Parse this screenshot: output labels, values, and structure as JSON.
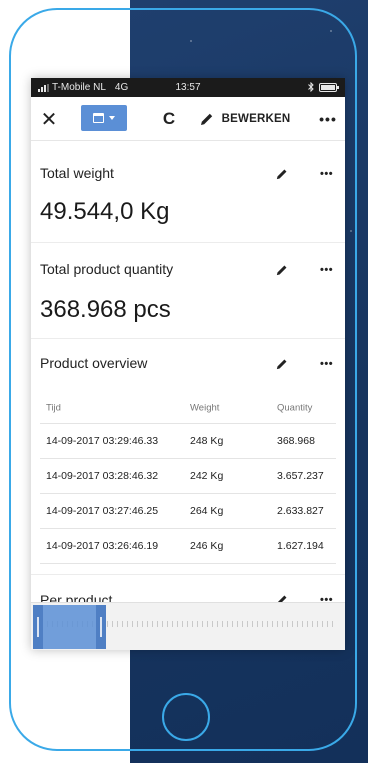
{
  "status_bar": {
    "carrier": "T-Mobile NL",
    "network": "4G",
    "time": "13:57",
    "bluetooth": "bluetooth-icon",
    "battery": "battery-icon"
  },
  "toolbar": {
    "close_icon": "✕",
    "refresh_icon": "C",
    "edit_label": "BEWERKEN",
    "more_icon": "•••"
  },
  "cards": {
    "total_weight": {
      "title": "Total weight",
      "value": "49.544,0 Kg"
    },
    "total_quantity": {
      "title": "Total product quantity",
      "value": "368.968 pcs"
    },
    "product_overview": {
      "title": "Product overview",
      "columns": [
        "Tijd",
        "Weight",
        "Quantity"
      ],
      "rows": [
        [
          "14-09-2017 03:29:46.33",
          "248 Kg",
          "368.968"
        ],
        [
          "14-09-2017 03:28:46.32",
          "242 Kg",
          "3.657.237"
        ],
        [
          "14-09-2017 03:27:46.25",
          "264 Kg",
          "2.633.827"
        ],
        [
          "14-09-2017 03:26:46.19",
          "246 Kg",
          "1.627.194"
        ]
      ]
    },
    "per_product": {
      "title": "Per product"
    }
  },
  "colors": {
    "accent": "#5b8fd6",
    "phone_outline": "#3aa9e8",
    "background_dark": "#1b3a66"
  }
}
